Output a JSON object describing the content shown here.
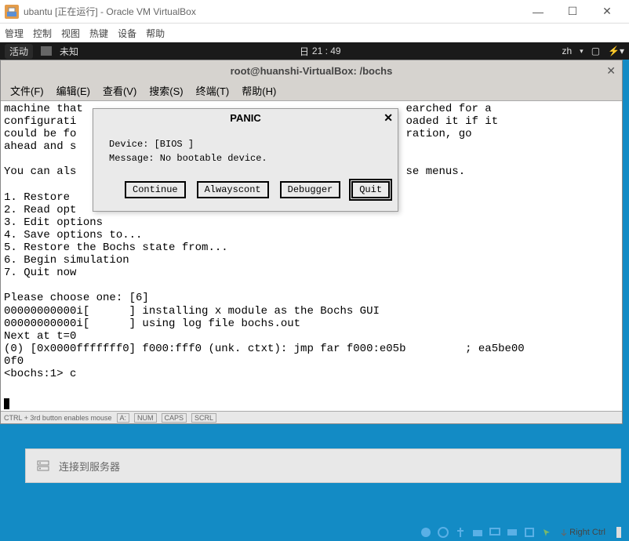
{
  "vbox": {
    "title": "ubantu [正在运行] - Oracle VM VirtualBox",
    "menus": [
      "管理",
      "控制",
      "视图",
      "热键",
      "设备",
      "帮助"
    ],
    "win_min": "—",
    "win_max": "☐",
    "win_close": "✕"
  },
  "gnome": {
    "activities": "活动",
    "app_label": "未知",
    "day": "日",
    "time": "21 : 49",
    "lang": "zh",
    "tray_square": "▢",
    "tray_batt": "⚡▾"
  },
  "terminal": {
    "title": "root@huanshi-VirtualBox: /bochs",
    "close": "✕",
    "menus": [
      "文件(F)",
      "编辑(E)",
      "查看(V)",
      "搜索(S)",
      "终端(T)",
      "帮助(H)"
    ],
    "content": "machine that                                                 earched for a\nconfigurati                                                  oaded it if it\ncould be fo                                                  ration, go\nahead and s\n\nYou can als                                                  se menus.\n\n1. Restore \n2. Read opt\n3. Edit options\n4. Save options to...\n5. Restore the Bochs state from...\n6. Begin simulation\n7. Quit now\n\nPlease choose one: [6]\n00000000000i[      ] installing x module as the Bochs GUI\n00000000000i[      ] using log file bochs.out\nNext at t=0\n(0) [0x0000fffffff0] f000:fff0 (unk. ctxt): jmp far f000:e05b         ; ea5be00\n0f0\n<bochs:1> c",
    "status_mouse": "CTRL + 3rd button enables mouse",
    "status_a": "A:",
    "status_num": "NUM",
    "status_caps": "CAPS",
    "status_scrl": "SCRL"
  },
  "panic": {
    "title": "PANIC",
    "close": "✕",
    "device_line": "Device: [BIOS ]",
    "message_line": "Message: No bootable device.",
    "btn_continue": "Continue",
    "btn_always": "Alwayscont",
    "btn_debugger": "Debugger",
    "btn_quit": "Quit"
  },
  "connect": {
    "label": "连接到服务器"
  },
  "tray": {
    "right_ctrl": "Right Ctrl"
  },
  "colors": {
    "desktop_bg": "#138bc5",
    "panel_dark": "#1a1a1a",
    "window_chrome": "#d6d3cf"
  }
}
